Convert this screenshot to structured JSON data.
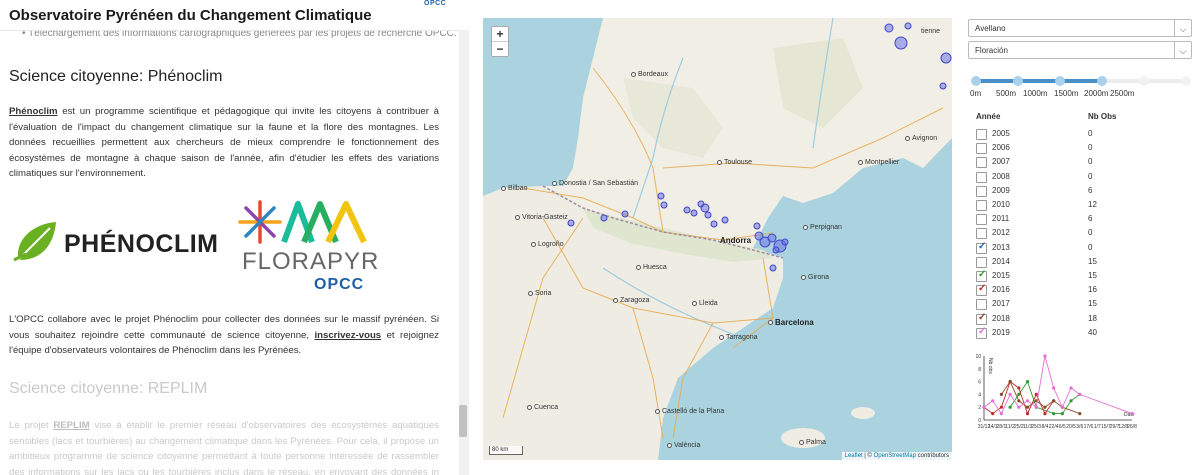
{
  "header": {
    "title": "Observatoire Pyrénéen du Changement Climatique",
    "brand": "OPCC"
  },
  "left": {
    "cut_bullet": "Téléchargement des informations cartographiques générées par les projets de recherche OPCC.",
    "section1": {
      "heading": "Science citoyenne: Phénoclim",
      "p1_link": "Phénoclim",
      "p1_rest": "est un programme scientifique et pédagogique qui invite les citoyens à contribuer à l'évaluation de l'impact du changement climatique sur la faune et la flore des montagnes. Les données recueillies permettent aux chercheurs de mieux comprendre le fonctionnement des écosystèmes de montagne à chaque saison de l'année, afin d'étudier les effets des variations climatiques sur l'environnement.",
      "p2_a": "L'OPCC collabore avec le projet Phénoclim pour collecter des données sur le massif pyrénéen. Si vous souhaitez rejoindre cette communauté de science citoyenne,",
      "p2_link": "inscrivez-vous",
      "p2_b": "et rejoignez l'équipe d'observateurs volontaires de Phénoclim dans les Pyrénées."
    },
    "logos": {
      "phenoclim": "PHÉNOCLIM",
      "florapyr": "FLORAPYR",
      "florapyr_sub": "OPCC"
    },
    "section2": {
      "heading": "Science citoyenne: REPLIM",
      "p_prefix": "Le projet",
      "p_link": "REPLIM",
      "p_rest": "vise à établir le premier réseau d'observatoires des écosystèmes aquatiques sensibles (lacs et tourbières) au changement climatique dans les Pyrénées. Pour cela, il propose un ambitieux programme de science citoyenne permettant à toute personne intéressée de rassembler des informations sur les lacs ou les tourbières inclus dans le réseau, en envoyant des données in situ"
    }
  },
  "map": {
    "zoom_in": "+",
    "zoom_out": "−",
    "scale": "80 km",
    "attribution_leaflet": "Leaflet",
    "attribution_sep": " | © ",
    "attribution_osm": "OpenStreetMap",
    "attribution_tail": " contributors",
    "cities": [
      {
        "name": "Bordeaux",
        "kind": "normal"
      },
      {
        "name": "Toulouse",
        "kind": "normal"
      },
      {
        "name": "Montpellier",
        "kind": "normal"
      },
      {
        "name": "Avignon",
        "kind": "normal"
      },
      {
        "name": "Donostia / San Sebastián",
        "kind": "normal"
      },
      {
        "name": "Bilbao",
        "kind": "normal"
      },
      {
        "name": "Vitoria-Gasteiz",
        "kind": "normal"
      },
      {
        "name": "Logroño",
        "kind": "normal"
      },
      {
        "name": "Andorra",
        "kind": "bold"
      },
      {
        "name": "Perpignan",
        "kind": "normal"
      },
      {
        "name": "Huesca",
        "kind": "normal"
      },
      {
        "name": "Girona",
        "kind": "normal"
      },
      {
        "name": "Soria",
        "kind": "normal"
      },
      {
        "name": "Zaragoza",
        "kind": "normal"
      },
      {
        "name": "Lleida",
        "kind": "normal"
      },
      {
        "name": "Barcelona",
        "kind": "normal"
      },
      {
        "name": "Tarragona",
        "kind": "normal"
      },
      {
        "name": "Cuenca",
        "kind": "normal"
      },
      {
        "name": "Castelló de la Plana",
        "kind": "normal"
      },
      {
        "name": "València",
        "kind": "normal"
      },
      {
        "name": "Palma",
        "kind": "normal"
      },
      {
        "name": "tienne",
        "kind": "normal"
      }
    ]
  },
  "controls": {
    "species": "Avellano",
    "stage": "Floración",
    "altitude_labels": [
      "0m",
      "500m",
      "1000m",
      "1500m",
      "2000m",
      "2500m"
    ],
    "altitude_selected_index": 4,
    "col_year": "Année",
    "col_obs": "Nb Obs",
    "rows": [
      {
        "year": "2005",
        "obs": "0",
        "checked": false,
        "color": ""
      },
      {
        "year": "2006",
        "obs": "0",
        "checked": false,
        "color": ""
      },
      {
        "year": "2007",
        "obs": "0",
        "checked": false,
        "color": ""
      },
      {
        "year": "2008",
        "obs": "0",
        "checked": false,
        "color": ""
      },
      {
        "year": "2009",
        "obs": "6",
        "checked": false,
        "color": ""
      },
      {
        "year": "2010",
        "obs": "12",
        "checked": false,
        "color": ""
      },
      {
        "year": "2011",
        "obs": "6",
        "checked": false,
        "color": ""
      },
      {
        "year": "2012",
        "obs": "0",
        "checked": false,
        "color": ""
      },
      {
        "year": "2013",
        "obs": "0",
        "checked": true,
        "color": "#1f5fb8"
      },
      {
        "year": "2014",
        "obs": "15",
        "checked": false,
        "color": ""
      },
      {
        "year": "2015",
        "obs": "15",
        "checked": true,
        "color": "#2e9a2e"
      },
      {
        "year": "2016",
        "obs": "16",
        "checked": true,
        "color": "#c62828"
      },
      {
        "year": "2017",
        "obs": "15",
        "checked": false,
        "color": ""
      },
      {
        "year": "2018",
        "obs": "18",
        "checked": true,
        "color": "#8a4a2a"
      },
      {
        "year": "2019",
        "obs": "40",
        "checked": true,
        "color": "#e070d8"
      }
    ]
  },
  "chart_data": {
    "type": "line",
    "ylabel": "Nb obs",
    "xlabel": "Date",
    "ylim": [
      0,
      10
    ],
    "yticks": [
      0,
      2,
      4,
      6,
      8,
      10
    ],
    "xtick_labels": [
      "31/12",
      "14/1",
      "28/1",
      "11/2",
      "25/2",
      "11/3",
      "25/3",
      "8/4",
      "22/4",
      "6/5",
      "20/5",
      "3/6",
      "17/6",
      "1/7",
      "15/7",
      "29/7",
      "12/8",
      "26/8"
    ],
    "x_categories": 18,
    "series": [
      {
        "name": "2015",
        "color": "#2e9a2e",
        "points": [
          [
            3,
            2
          ],
          [
            4,
            4
          ],
          [
            5,
            6
          ],
          [
            6,
            2
          ],
          [
            8,
            1
          ],
          [
            9,
            1
          ],
          [
            10,
            3
          ],
          [
            11,
            4
          ]
        ]
      },
      {
        "name": "2016",
        "color": "#c62828",
        "points": [
          [
            0,
            2
          ],
          [
            1,
            1
          ],
          [
            2,
            2
          ],
          [
            3,
            6
          ],
          [
            4,
            5
          ],
          [
            5,
            1
          ],
          [
            6,
            4
          ],
          [
            7,
            1
          ],
          [
            8,
            3
          ]
        ]
      },
      {
        "name": "2018",
        "color": "#8a4a2a",
        "points": [
          [
            2,
            4
          ],
          [
            3,
            6
          ],
          [
            4,
            3
          ],
          [
            5,
            2
          ],
          [
            6,
            3
          ],
          [
            7,
            2
          ],
          [
            8,
            3
          ],
          [
            9,
            2
          ],
          [
            11,
            1
          ]
        ]
      },
      {
        "name": "2019",
        "color": "#e070d8",
        "points": [
          [
            0,
            2
          ],
          [
            1,
            3
          ],
          [
            2,
            1
          ],
          [
            3,
            4
          ],
          [
            4,
            2
          ],
          [
            5,
            3
          ],
          [
            6,
            2
          ],
          [
            7,
            10
          ],
          [
            8,
            5
          ],
          [
            9,
            2
          ],
          [
            10,
            5
          ],
          [
            11,
            4
          ],
          [
            17,
            1
          ]
        ]
      }
    ]
  }
}
